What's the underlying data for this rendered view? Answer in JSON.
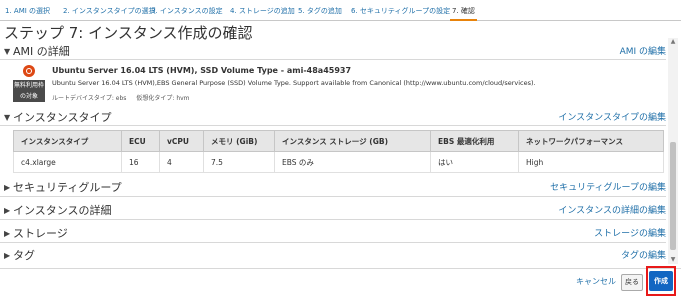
{
  "wizard": {
    "tabs": [
      {
        "label": "1. AMI の選択"
      },
      {
        "label": "2. インスタンスタイプの選択"
      },
      {
        "label": "3. インスタンスの設定"
      },
      {
        "label": "4. ストレージの追加"
      },
      {
        "label": "5. タグの追加"
      },
      {
        "label": "6. セキュリティグループの設定"
      },
      {
        "label": "7. 確認"
      }
    ],
    "active_tab": "7. 確認"
  },
  "page_title": "ステップ 7: インスタンス作成の確認",
  "ami": {
    "header": "AMI の詳細",
    "edit_label": "AMI の編集",
    "icon": "ubuntu-logo",
    "badge_line1": "無料利用枠",
    "badge_line2": "の対象",
    "name": "Ubuntu Server 16.04 LTS (HVM), SSD Volume Type - ami-48a45937",
    "description": "Ubuntu Server 16.04 LTS (HVM),EBS General Purpose (SSD) Volume Type. Support available from Canonical (http://www.ubuntu.com/cloud/services).",
    "root_device": "ルートデバイスタイプ: ebs",
    "virtualization": "仮想化タイプ: hvm"
  },
  "instance_type": {
    "header": "インスタンスタイプ",
    "edit_label": "インスタンスタイプの編集",
    "columns": [
      "インスタンスタイプ",
      "ECU",
      "vCPU",
      "メモリ (GiB)",
      "インスタンス ストレージ (GB)",
      "EBS 最適化利用",
      "ネットワークパフォーマンス"
    ],
    "rows": [
      [
        "c4.xlarge",
        "16",
        "4",
        "7.5",
        "EBS のみ",
        "はい",
        "High"
      ]
    ]
  },
  "security_groups": {
    "header": "セキュリティグループ",
    "edit_label": "セキュリティグループの編集"
  },
  "instance_details": {
    "header": "インスタンスの詳細",
    "edit_label": "インスタンスの詳細の編集"
  },
  "storage": {
    "header": "ストレージ",
    "edit_label": "ストレージの編集"
  },
  "tags": {
    "header": "タグ",
    "edit_label": "タグの編集"
  },
  "footer": {
    "cancel_label": "キャンセル",
    "back_label": "戻る",
    "launch_label": "作成",
    "highlight_color": "#e81919",
    "primary_color": "#1266c2"
  },
  "icons": {
    "expanded": "caret-down-icon",
    "collapsed": "caret-right-icon",
    "expanded_glyph": "▼",
    "collapsed_glyph": "▶"
  }
}
